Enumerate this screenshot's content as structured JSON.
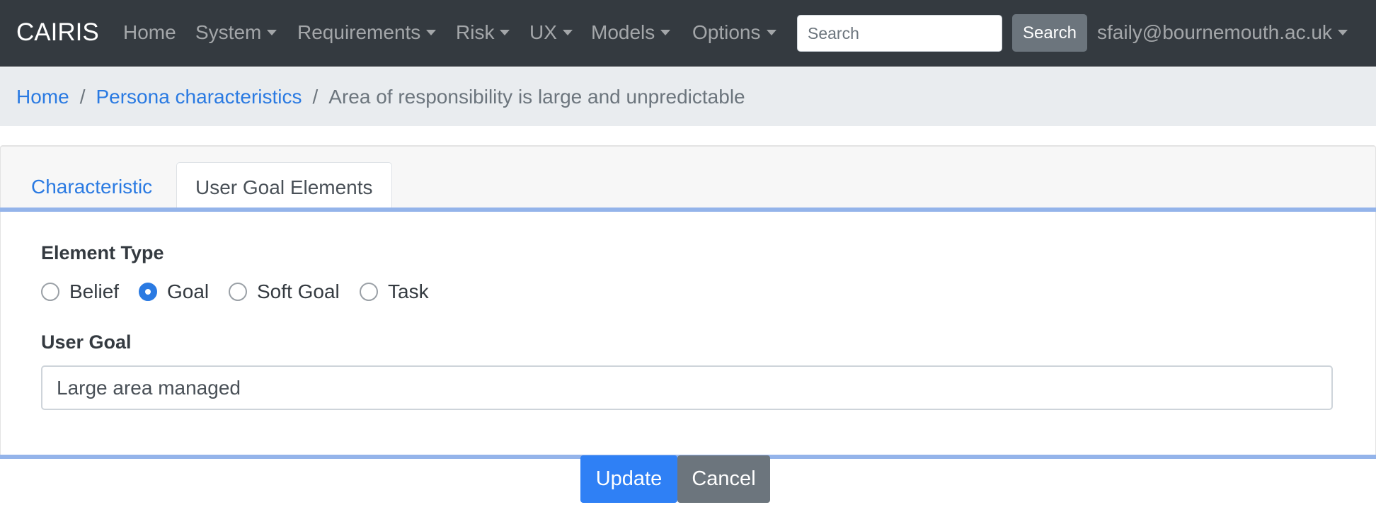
{
  "navbar": {
    "brand": "CAIRIS",
    "items": [
      {
        "label": "Home",
        "dropdown": false
      },
      {
        "label": "System",
        "dropdown": true
      },
      {
        "label": "Requirements",
        "dropdown": true
      },
      {
        "label": "Risk",
        "dropdown": true
      },
      {
        "label": "UX",
        "dropdown": true
      },
      {
        "label": "Models",
        "dropdown": true
      },
      {
        "label": "Options",
        "dropdown": true
      }
    ],
    "search_placeholder": "Search",
    "search_button": "Search",
    "user": "sfaily@bournemouth.ac.uk"
  },
  "breadcrumb": {
    "items": [
      "Home",
      "Persona characteristics"
    ],
    "separator": "/",
    "active": "Area of responsibility is large and unpredictable"
  },
  "tabs": [
    {
      "label": "Characteristic",
      "active": false
    },
    {
      "label": "User Goal Elements",
      "active": true
    }
  ],
  "form": {
    "element_type_label": "Element Type",
    "element_types": [
      {
        "label": "Belief",
        "checked": false
      },
      {
        "label": "Goal",
        "checked": true
      },
      {
        "label": "Soft Goal",
        "checked": false
      },
      {
        "label": "Task",
        "checked": false
      }
    ],
    "user_goal_label": "User Goal",
    "user_goal_value": "Large area managed"
  },
  "actions": {
    "update": "Update",
    "cancel": "Cancel"
  },
  "colors": {
    "navbar": "#343a40",
    "link": "#2a7ae2",
    "primary_button": "#2f80f5",
    "secondary_button": "#6c757d",
    "tab_rule": "#94b4ea"
  }
}
